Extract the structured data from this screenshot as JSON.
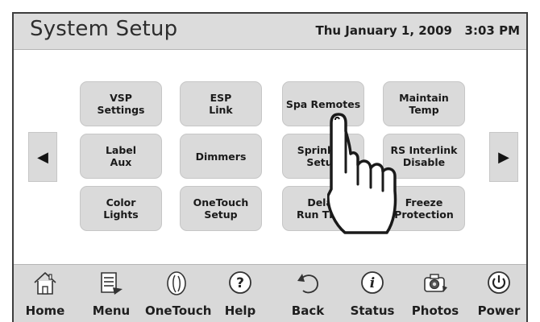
{
  "header": {
    "title": "System Setup",
    "date": "Thu January 1, 2009",
    "time": "3:03 PM"
  },
  "arrows": {
    "left": "◀",
    "right": "▶"
  },
  "grid": [
    {
      "name": "vsp-settings-button",
      "label": "VSP\nSettings"
    },
    {
      "name": "esp-link-button",
      "label": "ESP\nLink"
    },
    {
      "name": "spa-remotes-button",
      "label": "Spa Remotes"
    },
    {
      "name": "maintain-temp-button",
      "label": "Maintain\nTemp"
    },
    {
      "name": "label-aux-button",
      "label": "Label\nAux"
    },
    {
      "name": "dimmers-button",
      "label": "Dimmers"
    },
    {
      "name": "sprinkler-setup-button",
      "label": "Sprinkler\nSetup"
    },
    {
      "name": "rs-interlink-disable-button",
      "label": "RS Interlink\nDisable"
    },
    {
      "name": "color-lights-button",
      "label": "Color\nLights"
    },
    {
      "name": "onetouch-setup-button",
      "label": "OneTouch\nSetup"
    },
    {
      "name": "delay-run-time-button",
      "label": "Delay\nRun Time"
    },
    {
      "name": "freeze-protection-button",
      "label": "Freeze\nProtection"
    }
  ],
  "nav": [
    {
      "name": "home",
      "label": "Home",
      "icon": "house-icon"
    },
    {
      "name": "menu",
      "label": "Menu",
      "icon": "menu-page-icon"
    },
    {
      "name": "onetouch",
      "label": "OneTouch",
      "icon": "onetouch-icon"
    },
    {
      "name": "help",
      "label": "Help",
      "icon": "help-icon"
    },
    {
      "name": "back",
      "label": "Back",
      "icon": "back-icon"
    },
    {
      "name": "status",
      "label": "Status",
      "icon": "info-icon"
    },
    {
      "name": "photos",
      "label": "Photos",
      "icon": "camera-icon"
    },
    {
      "name": "power",
      "label": "Power",
      "icon": "power-icon"
    }
  ]
}
